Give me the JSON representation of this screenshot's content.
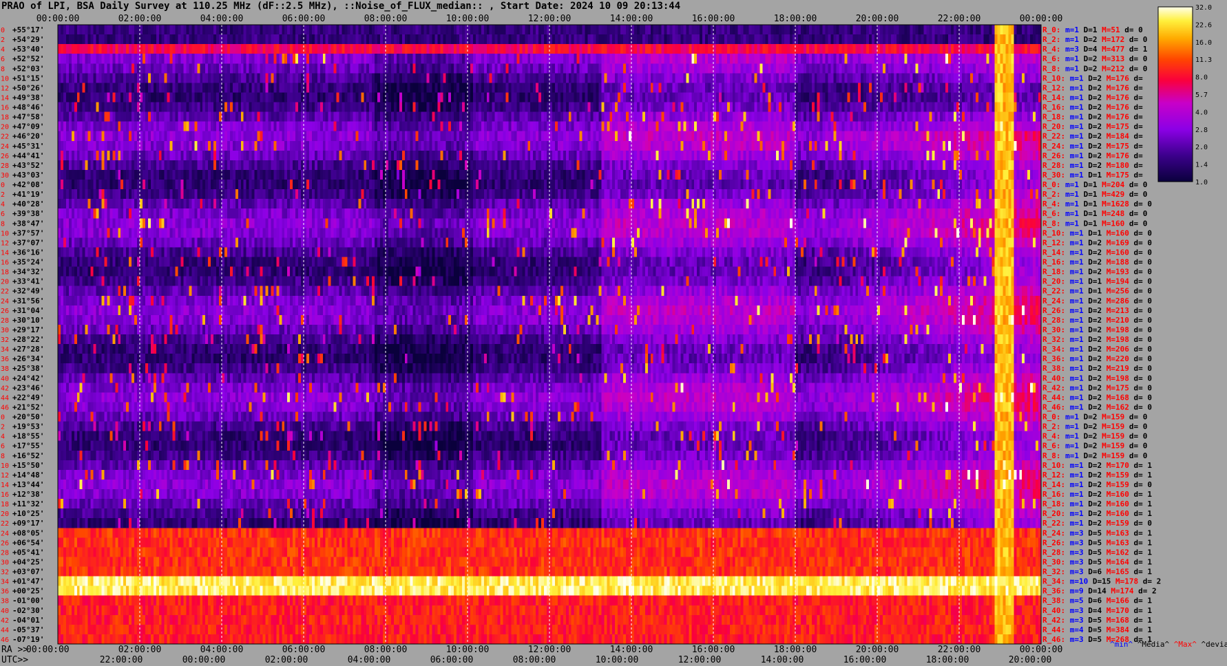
{
  "header": {
    "title": "PRAO of LPI, BSA Daily Survey at 110.25 MHz (dF::2.5 MHz), ::Noise_of_FLUX_median:: , Start Date: 2024 10 09 20:13:44"
  },
  "colorbar": {
    "ticks": [
      "32.0",
      "22.6",
      "16.0",
      "11.3",
      "8.0",
      "5.7",
      "4.0",
      "2.8",
      "2.0",
      "1.4",
      "1.0"
    ]
  },
  "chart_data": {
    "type": "heatmap",
    "title": "PRAO of LPI, BSA Daily Survey at 110.25 MHz (dF::2.5 MHz), ::Noise_of_FLUX_median:: , Start Date: 2024 10 09 20:13:44",
    "x_top_ticks": [
      "00:00:00",
      "02:00:00",
      "04:00:00",
      "06:00:00",
      "08:00:00",
      "10:00:00",
      "12:00:00",
      "14:00:00",
      "16:00:00",
      "18:00:00",
      "20:00:00",
      "22:00:00",
      "00:00:00"
    ],
    "x_bottom_ra_label": "RA >>",
    "x_bottom_ra_ticks": [
      "00:00:00",
      "02:00:00",
      "04:00:00",
      "06:00:00",
      "08:00:00",
      "10:00:00",
      "12:00:00",
      "14:00:00",
      "16:00:00",
      "18:00:00",
      "20:00:00",
      "22:00:00",
      "00:00:00"
    ],
    "x_bottom_utc_label": "UTC>>",
    "x_bottom_utc_ticks": [
      "22:00:00",
      "00:00:00",
      "02:00:00",
      "04:00:00",
      "06:00:00",
      "08:00:00",
      "10:00:00",
      "12:00:00",
      "14:00:00",
      "16:00:00",
      "18:00:00",
      "20:00:00"
    ],
    "declinations": [
      "+55°17'",
      "+54°29'",
      "+53°40'",
      "+52°52'",
      "+52°03'",
      "+51°15'",
      "+50°26'",
      "+49°38'",
      "+48°46'",
      "+47°58'",
      "+47°09'",
      "+46°20'",
      "+45°31'",
      "+44°41'",
      "+43°52'",
      "+43°03'",
      "+42°08'",
      "+41°19'",
      "+40°28'",
      "+39°38'",
      "+38°47'",
      "+37°57'",
      "+37°07'",
      "+36°16'",
      "+35°24'",
      "+34°32'",
      "+33°41'",
      "+32°49'",
      "+31°56'",
      "+31°04'",
      "+30°10'",
      "+29°17'",
      "+28°22'",
      "+27°28'",
      "+26°34'",
      "+25°38'",
      "+24°42'",
      "+23°46'",
      "+22°49'",
      "+21°52'",
      "+20°50'",
      "+19°53'",
      "+18°55'",
      "+17°55'",
      "+16°52'",
      "+15°50'",
      "+14°48'",
      "+13°44'",
      "+12°38'",
      "+11°32'",
      "+10°25'",
      "+09°17'",
      "+08°05'",
      "+06°54'",
      "+05°41'",
      "+04°25'",
      "+03°07'",
      "+01°47'",
      "+00°25'",
      "-01°00'",
      "-02°30'",
      "-04°01'",
      "-05°37'",
      "-07°19'"
    ],
    "row_ids": [
      "0",
      "2",
      "4",
      "6",
      "8",
      "10",
      "12",
      "14",
      "16",
      "18",
      "20",
      "22",
      "24",
      "26",
      "28",
      "30",
      "0",
      "2",
      "4",
      "6",
      "8",
      "10",
      "12",
      "14",
      "16",
      "18",
      "20",
      "22",
      "24",
      "26",
      "28",
      "30",
      "32",
      "34",
      "36",
      "38",
      "40",
      "42",
      "44",
      "46",
      "0",
      "2",
      "4",
      "6",
      "8",
      "10",
      "12",
      "14",
      "16",
      "18",
      "20",
      "22",
      "24",
      "26",
      "28",
      "30",
      "32",
      "34",
      "36",
      "38",
      "40",
      "42",
      "44",
      "46"
    ],
    "stats": [
      {
        "r": "R_0:",
        "m": "m=1",
        "D": "D=1",
        "M": "M=51",
        "d": "d= 0"
      },
      {
        "r": "R_2:",
        "m": "m=1",
        "D": "D=2",
        "M": "M=172",
        "d": "d= 0"
      },
      {
        "r": "R_4:",
        "m": "m=3",
        "D": "D=4",
        "M": "M=477",
        "d": "d= 1"
      },
      {
        "r": "R_6:",
        "m": "m=1",
        "D": "D=2",
        "M": "M=313",
        "d": "d= 0"
      },
      {
        "r": "R_8:",
        "m": "m=1",
        "D": "D=2",
        "M": "M=212",
        "d": "d= 0"
      },
      {
        "r": "R_10:",
        "m": "m=1",
        "D": "D=2",
        "M": "M=176",
        "d": "d="
      },
      {
        "r": "R_12:",
        "m": "m=1",
        "D": "D=2",
        "M": "M=176",
        "d": "d="
      },
      {
        "r": "R_14:",
        "m": "m=1",
        "D": "D=2",
        "M": "M=176",
        "d": "d="
      },
      {
        "r": "R_16:",
        "m": "m=1",
        "D": "D=2",
        "M": "M=176",
        "d": "d="
      },
      {
        "r": "R_18:",
        "m": "m=1",
        "D": "D=2",
        "M": "M=176",
        "d": "d="
      },
      {
        "r": "R_20:",
        "m": "m=1",
        "D": "D=2",
        "M": "M=175",
        "d": "d="
      },
      {
        "r": "R_22:",
        "m": "m=1",
        "D": "D=2",
        "M": "M=184",
        "d": "d="
      },
      {
        "r": "R_24:",
        "m": "m=1",
        "D": "D=2",
        "M": "M=175",
        "d": "d="
      },
      {
        "r": "R_26:",
        "m": "m=1",
        "D": "D=2",
        "M": "M=176",
        "d": "d="
      },
      {
        "r": "R_28:",
        "m": "m=1",
        "D": "D=2",
        "M": "M=180",
        "d": "d="
      },
      {
        "r": "R_30:",
        "m": "m=1",
        "D": "D=1",
        "M": "M=175",
        "d": "d="
      },
      {
        "r": "R_0:",
        "m": "m=1",
        "D": "D=1",
        "M": "M=204",
        "d": "d= 0"
      },
      {
        "r": "R_2:",
        "m": "m=1",
        "D": "D=1",
        "M": "M=429",
        "d": "d= 0"
      },
      {
        "r": "R_4:",
        "m": "m=1",
        "D": "D=1",
        "M": "M=1628",
        "d": "d= 0"
      },
      {
        "r": "R_6:",
        "m": "m=1",
        "D": "D=1",
        "M": "M=248",
        "d": "d= 0"
      },
      {
        "r": "R_8:",
        "m": "m=1",
        "D": "D=1",
        "M": "M=160",
        "d": "d= 0"
      },
      {
        "r": "R_10:",
        "m": "m=1",
        "D": "D=1",
        "M": "M=160",
        "d": "d= 0"
      },
      {
        "r": "R_12:",
        "m": "m=1",
        "D": "D=2",
        "M": "M=169",
        "d": "d= 0"
      },
      {
        "r": "R_14:",
        "m": "m=1",
        "D": "D=2",
        "M": "M=160",
        "d": "d= 0"
      },
      {
        "r": "R_16:",
        "m": "m=1",
        "D": "D=2",
        "M": "M=188",
        "d": "d= 0"
      },
      {
        "r": "R_18:",
        "m": "m=1",
        "D": "D=2",
        "M": "M=193",
        "d": "d= 0"
      },
      {
        "r": "R_20:",
        "m": "m=1",
        "D": "D=1",
        "M": "M=194",
        "d": "d= 0"
      },
      {
        "r": "R_22:",
        "m": "m=1",
        "D": "D=1",
        "M": "M=256",
        "d": "d= 0"
      },
      {
        "r": "R_24:",
        "m": "m=1",
        "D": "D=2",
        "M": "M=286",
        "d": "d= 0"
      },
      {
        "r": "R_26:",
        "m": "m=1",
        "D": "D=2",
        "M": "M=213",
        "d": "d= 0"
      },
      {
        "r": "R_28:",
        "m": "m=1",
        "D": "D=2",
        "M": "M=210",
        "d": "d= 0"
      },
      {
        "r": "R_30:",
        "m": "m=1",
        "D": "D=2",
        "M": "M=198",
        "d": "d= 0"
      },
      {
        "r": "R_32:",
        "m": "m=1",
        "D": "D=2",
        "M": "M=198",
        "d": "d= 0"
      },
      {
        "r": "R_34:",
        "m": "m=1",
        "D": "D=2",
        "M": "M=206",
        "d": "d= 0"
      },
      {
        "r": "R_36:",
        "m": "m=1",
        "D": "D=2",
        "M": "M=220",
        "d": "d= 0"
      },
      {
        "r": "R_38:",
        "m": "m=1",
        "D": "D=2",
        "M": "M=219",
        "d": "d= 0"
      },
      {
        "r": "R_40:",
        "m": "m=1",
        "D": "D=2",
        "M": "M=198",
        "d": "d= 0"
      },
      {
        "r": "R_42:",
        "m": "m=1",
        "D": "D=2",
        "M": "M=175",
        "d": "d= 0"
      },
      {
        "r": "R_44:",
        "m": "m=1",
        "D": "D=2",
        "M": "M=168",
        "d": "d= 0"
      },
      {
        "r": "R_46:",
        "m": "m=1",
        "D": "D=2",
        "M": "M=162",
        "d": "d= 0"
      },
      {
        "r": "R_0:",
        "m": "m=1",
        "D": "D=2",
        "M": "M=159",
        "d": "d= 0"
      },
      {
        "r": "R_2:",
        "m": "m=1",
        "D": "D=2",
        "M": "M=159",
        "d": "d= 0"
      },
      {
        "r": "R_4:",
        "m": "m=1",
        "D": "D=2",
        "M": "M=159",
        "d": "d= 0"
      },
      {
        "r": "R_6:",
        "m": "m=1",
        "D": "D=2",
        "M": "M=159",
        "d": "d= 0"
      },
      {
        "r": "R_8:",
        "m": "m=1",
        "D": "D=2",
        "M": "M=159",
        "d": "d= 0"
      },
      {
        "r": "R_10:",
        "m": "m=1",
        "D": "D=2",
        "M": "M=170",
        "d": "d= 1"
      },
      {
        "r": "R_12:",
        "m": "m=1",
        "D": "D=2",
        "M": "M=159",
        "d": "d= 1"
      },
      {
        "r": "R_14:",
        "m": "m=1",
        "D": "D=2",
        "M": "M=159",
        "d": "d= 0"
      },
      {
        "r": "R_16:",
        "m": "m=1",
        "D": "D=2",
        "M": "M=160",
        "d": "d= 1"
      },
      {
        "r": "R_18:",
        "m": "m=1",
        "D": "D=2",
        "M": "M=160",
        "d": "d= 1"
      },
      {
        "r": "R_20:",
        "m": "m=1",
        "D": "D=2",
        "M": "M=160",
        "d": "d= 1"
      },
      {
        "r": "R_22:",
        "m": "m=1",
        "D": "D=2",
        "M": "M=159",
        "d": "d= 0"
      },
      {
        "r": "R_24:",
        "m": "m=3",
        "D": "D=5",
        "M": "M=163",
        "d": "d= 1"
      },
      {
        "r": "R_26:",
        "m": "m=3",
        "D": "D=5",
        "M": "M=163",
        "d": "d= 1"
      },
      {
        "r": "R_28:",
        "m": "m=3",
        "D": "D=5",
        "M": "M=162",
        "d": "d= 1"
      },
      {
        "r": "R_30:",
        "m": "m=3",
        "D": "D=5",
        "M": "M=164",
        "d": "d= 1"
      },
      {
        "r": "R_32:",
        "m": "m=3",
        "D": "D=6",
        "M": "M=165",
        "d": "d= 1"
      },
      {
        "r": "R_34:",
        "m": "m=10",
        "D": "D=15",
        "M": "M=178",
        "d": "d= 2"
      },
      {
        "r": "R_36:",
        "m": "m=9",
        "D": "D=14",
        "M": "M=174",
        "d": "d= 2"
      },
      {
        "r": "R_38:",
        "m": "m=5",
        "D": "D=6",
        "M": "M=166",
        "d": "d= 1"
      },
      {
        "r": "R_40:",
        "m": "m=3",
        "D": "D=4",
        "M": "M=170",
        "d": "d= 1"
      },
      {
        "r": "R_42:",
        "m": "m=3",
        "D": "D=5",
        "M": "M=168",
        "d": "d= 1"
      },
      {
        "r": "R_44:",
        "m": "m=4",
        "D": "D=5",
        "M": "M=384",
        "d": "d= 1"
      },
      {
        "r": "R_46:",
        "m": "m=3",
        "D": "D=5",
        "M": "M=268",
        "d": "d= 1"
      }
    ],
    "stats_legend": [
      "^min^",
      "^Media^",
      "^Max^",
      "^devia^"
    ],
    "colors": {
      "background": "#a4a4a4",
      "stat_label": "#ff0000",
      "stat_value": "#0000ff"
    }
  }
}
